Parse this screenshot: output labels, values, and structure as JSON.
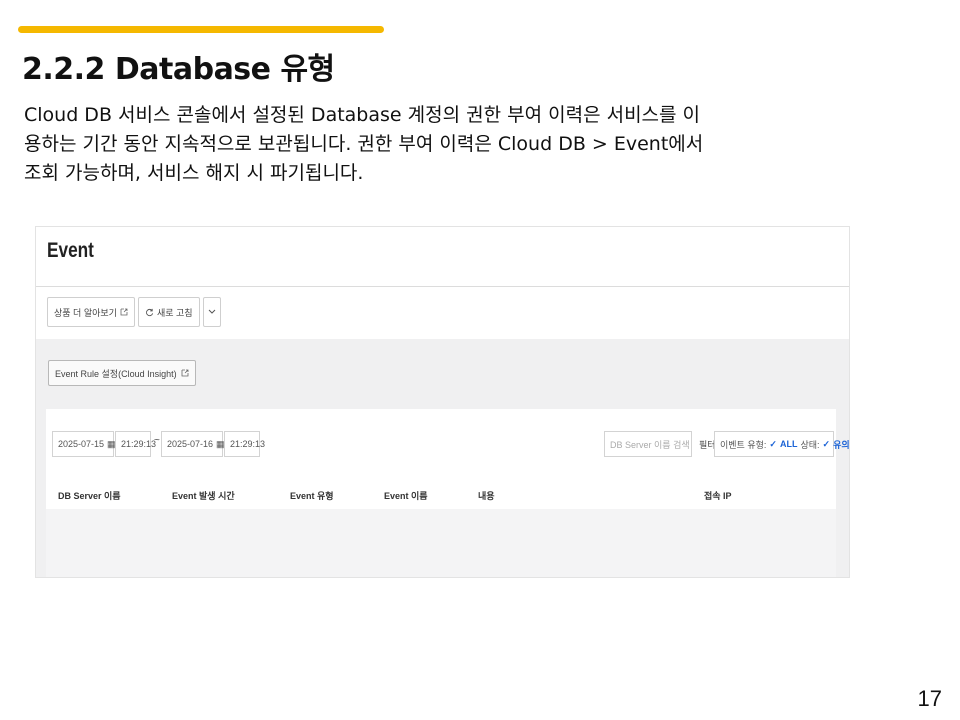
{
  "slide": {
    "title": "2.2.2 Database 유형",
    "body_lines": [
      "Cloud DB 서비스 콘솔에서 설정된 Database 계정의 권한 부여 이력은 서비스를 이",
      "용하는 기간 동안 지속적으로 보관됩니다. 권한 부여 이력은 Cloud DB > Event에서",
      "조회 가능하며, 서비스 해지 시 파기됩니다."
    ],
    "page_number": "17",
    "accent_color": "#f5b800"
  },
  "screenshot": {
    "title": "Event",
    "toolbar": {
      "product_more": "상품 더 알아보기",
      "refresh": "새로 고침"
    },
    "rule_button": "Event Rule 설정(Cloud Insight)",
    "filters": {
      "start_date": "2025-07-15",
      "start_time": "21:29:13",
      "separator": "~",
      "end_date": "2025-07-16",
      "end_time": "21:29:13",
      "search_placeholder": "DB Server 이름 검색",
      "filter_label": "필터",
      "event_type": "이벤트 유형:",
      "event_type_value": "ALL",
      "status": "상태:",
      "status_value": "유의중"
    },
    "columns": [
      "DB Server 이름",
      "Event 발생 시간",
      "Event 유형",
      "Event 이름",
      "내용",
      "접속 IP"
    ]
  }
}
